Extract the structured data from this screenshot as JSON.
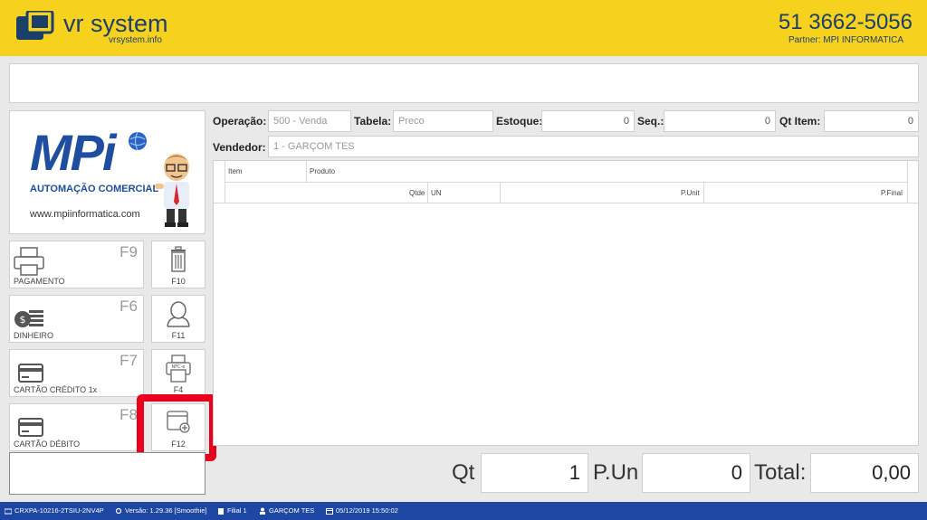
{
  "header": {
    "brand": "vr system",
    "brand_sub": "vrsystem.info",
    "phone": "51 3662-5056",
    "partner": "Partner: MPI INFORMATICA"
  },
  "logo_panel": {
    "mpi": "MPi",
    "subtitle": "AUTOMAÇÃO COMERCIAL",
    "url": "www.mpiinformatica.com"
  },
  "function_buttons": [
    {
      "key": "F9",
      "label": "PAGAMENTO",
      "icon": "printer-icon"
    },
    {
      "key": "F6",
      "label": "DINHEIRO",
      "icon": "money-icon"
    },
    {
      "key": "F7",
      "label": "CARTÃO CRÉDITO 1x",
      "icon": "credit-card-icon"
    },
    {
      "key": "F8",
      "label": "CARTÃO DÉBITO",
      "icon": "debit-card-icon"
    }
  ],
  "side_buttons": [
    {
      "key": "F10",
      "icon": "trash-icon"
    },
    {
      "key": "F11",
      "icon": "user-icon"
    },
    {
      "key": "F4",
      "icon": "nfce-printer-icon",
      "icon_text": "NFC-e"
    },
    {
      "key": "F12",
      "icon": "new-window-icon"
    }
  ],
  "fields": {
    "operacao_label": "Operação:",
    "operacao_value": "500 - Venda",
    "tabela_label": "Tabela:",
    "tabela_placeholder": "Preco",
    "estoque_label": "Estoque:",
    "estoque_value": "0",
    "seq_label": "Seq.:",
    "seq_value": "0",
    "qtitem_label": "Qt Item:",
    "qtitem_value": "0",
    "vendedor_label": "Vendedor:",
    "vendedor_value": "1 - GARÇOM TES"
  },
  "grid": {
    "col_item": "Item",
    "col_produto": "Produto",
    "col_qtde": "Qtde",
    "col_un": "UN",
    "col_punit": "P.Unit",
    "col_pfinal": "P.Final"
  },
  "totals": {
    "qt_label": "Qt",
    "qt_value": "1",
    "pun_label": "P.Un",
    "pun_value": "0",
    "total_label": "Total:",
    "total_value": "0,00"
  },
  "status_bar": {
    "machine": "CRXPA-10216-2TSIU-2NV4P",
    "version": "Versão: 1.29.36 [Smoothie]",
    "filial": "Filial 1",
    "user": "GARÇOM TES",
    "datetime": "05/12/2019 15:50:02"
  },
  "colors": {
    "header_bg": "#f6d21e",
    "brand_blue": "#1b3f6b",
    "status_bg": "#1e46a3",
    "highlight": "#e8001c"
  }
}
